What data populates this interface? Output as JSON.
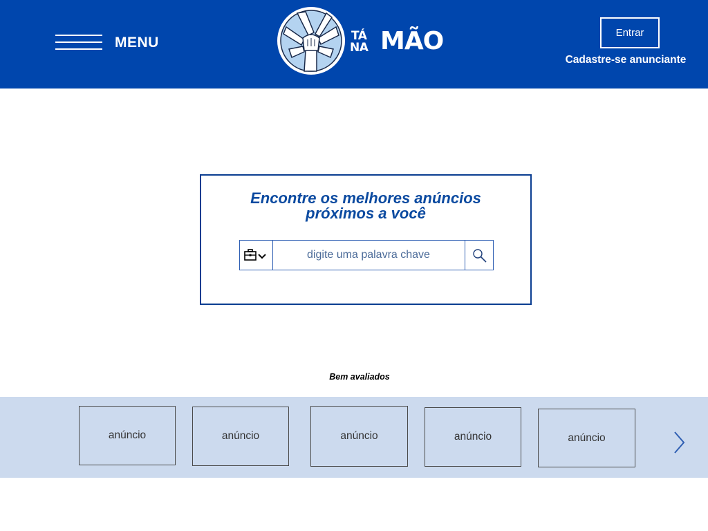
{
  "header": {
    "menu_label": "MENU",
    "logo": {
      "line1": "TÁ",
      "line2": "NA",
      "word": "MÃO"
    },
    "login_label": "Entrar",
    "signup_label": "Cadastre-se anunciante"
  },
  "search": {
    "title_line1": "Encontre os melhores anúncios",
    "title_line2": "próximos a você",
    "category_icon": "briefcase-icon",
    "placeholder": "digite uma palavra chave",
    "submit_icon": "search-icon"
  },
  "featured": {
    "title": "Bem avaliados",
    "items": [
      {
        "label": "anúncio"
      },
      {
        "label": "anúncio"
      },
      {
        "label": "anúncio"
      },
      {
        "label": "anúncio"
      },
      {
        "label": "anúncio"
      }
    ],
    "next_icon": "chevron-right-icon"
  },
  "colors": {
    "brand_blue": "#0046ad",
    "carousel_bg": "#ccdaee",
    "title_blue": "#0b4aa0"
  }
}
